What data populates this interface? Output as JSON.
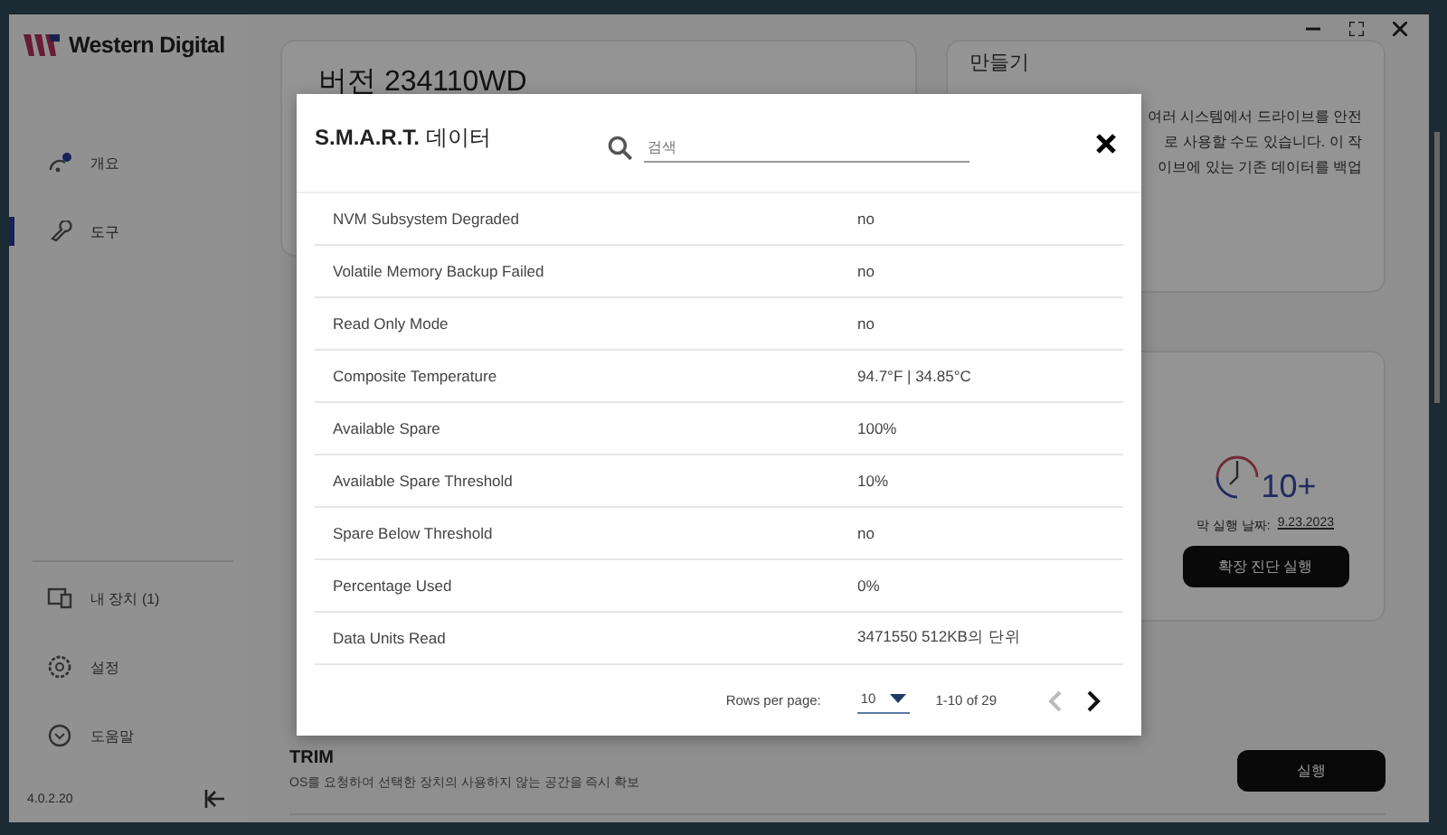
{
  "sidebar": {
    "logo": "Western Digital",
    "items": [
      {
        "label": "개요",
        "kind": "overview",
        "selected": false,
        "badge": true
      },
      {
        "label": "도구",
        "kind": "tools",
        "selected": true,
        "badge": false
      }
    ],
    "bottom_items": [
      {
        "label": "내 장치 (1)",
        "kind": "devices"
      },
      {
        "label": "설정",
        "kind": "settings"
      },
      {
        "label": "도움말",
        "kind": "help"
      }
    ],
    "version": "4.0.2.20"
  },
  "main": {
    "version_title": "버전 234110WD",
    "right_title": "만들기",
    "right_lines": [
      "여러 시스템에서 드라이브를 안전",
      "로 사용할 수도 있습니다. 이 작",
      "이브에 있는 기존 데이터를 백업"
    ],
    "diagnostic": {
      "badge": "10+",
      "last_run_label": "막 실행 날짜:",
      "last_run_date": "9.23.2023",
      "button": "확장 진단 실행"
    },
    "trim": {
      "title": "TRIM",
      "description": "OS를 요청하여 선택한 장치의 사용하지 않는 공간을 즉시 확보",
      "button": "실행"
    }
  },
  "dialog": {
    "title": "**S.M.A.R.T.** 데이터",
    "search": {
      "placeholder": "검색"
    },
    "rows": [
      {
        "name": "NVM Subsystem Degraded",
        "value": "no"
      },
      {
        "name": "Volatile Memory Backup Failed",
        "value": "no"
      },
      {
        "name": "Read Only Mode",
        "value": "no"
      },
      {
        "name": "Composite Temperature",
        "value": "94.7°F | 34.85°C"
      },
      {
        "name": "Available Spare",
        "value": "100%"
      },
      {
        "name": "Available Spare Threshold",
        "value": "10%"
      },
      {
        "name": "Spare Below Threshold",
        "value": "no"
      },
      {
        "name": "Percentage Used",
        "value": "0%"
      },
      {
        "name": "Data Units Read",
        "value": "3471550 512KB의 단위"
      }
    ],
    "pagination": {
      "rows_per_page_label": "Rows per page:",
      "rows_per_page": "10",
      "range": "1-10 of 29",
      "prev_disabled": true,
      "next_disabled": false
    }
  }
}
